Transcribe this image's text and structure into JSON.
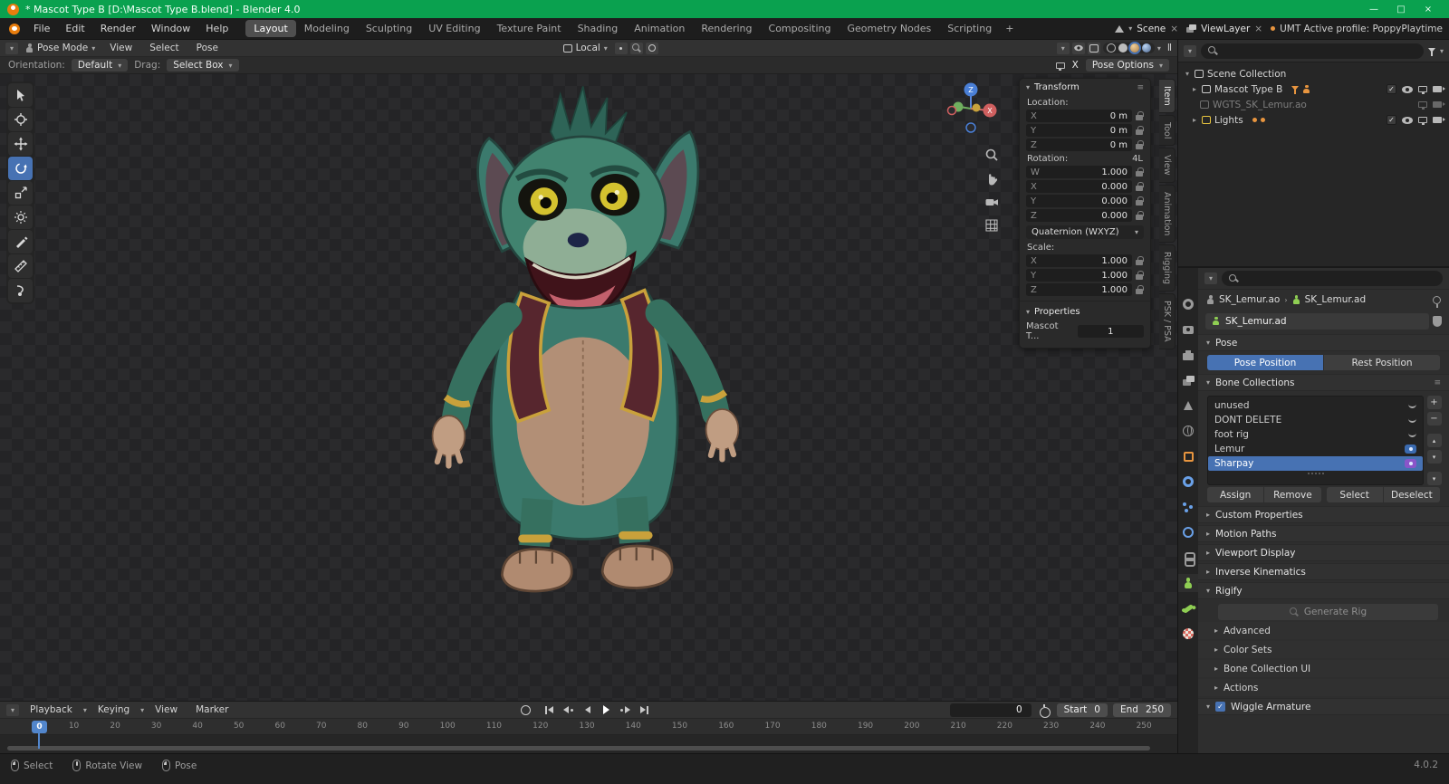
{
  "glyphs": {
    "chevron_down": "▾",
    "chevron_right": "▸",
    "chevron_up": "▴",
    "plus": "+",
    "minus": "−",
    "close": "×",
    "check": "✓",
    "grip": "≡",
    "pause": "Ⅱ",
    "minimize": "—",
    "maximize": "□",
    "crumb_sep": "›"
  },
  "window": {
    "title": "* Mascot Type B [D:\\Mascot Type B.blend] - Blender 4.0"
  },
  "menubar": {
    "menus": [
      "File",
      "Edit",
      "Render",
      "Window",
      "Help"
    ],
    "workspaces": [
      "Layout",
      "Modeling",
      "Sculpting",
      "UV Editing",
      "Texture Paint",
      "Shading",
      "Animation",
      "Rendering",
      "Compositing",
      "Geometry Nodes",
      "Scripting"
    ],
    "active_workspace": "Layout",
    "add_workspace": "+",
    "scene_selector": {
      "label": "Scene"
    },
    "viewlayer_selector": {
      "label": "ViewLayer"
    },
    "profile_text": "UMT Active profile: PoppyPlaytime"
  },
  "viewport": {
    "header": {
      "mode": "Pose Mode",
      "menus": [
        "View",
        "Select",
        "Pose"
      ],
      "orientation": "Local"
    },
    "subheader": {
      "orientation_label": "Orientation:",
      "orientation_value": "Default",
      "drag_label": "Drag:",
      "drag_value": "Select Box",
      "mirror_axis": "X",
      "pose_options": "Pose Options"
    },
    "gizmo": {
      "x": "X",
      "z": "Z"
    },
    "side_tabs": [
      "Item",
      "Tool",
      "View",
      "Animation",
      "Rigging",
      "PSK / PSA"
    ],
    "active_side_tab": "Item"
  },
  "n_panel": {
    "transform_title": "Transform",
    "location_label": "Location:",
    "location_rows": [
      {
        "axis": "X",
        "value": "0 m"
      },
      {
        "axis": "Y",
        "value": "0 m"
      },
      {
        "axis": "Z",
        "value": "0 m"
      }
    ],
    "rotation_label": "Rotation:",
    "rotation_badge": "4L",
    "rotation_rows": [
      {
        "axis": "W",
        "value": "1.000"
      },
      {
        "axis": "X",
        "value": "0.000"
      },
      {
        "axis": "Y",
        "value": "0.000"
      },
      {
        "axis": "Z",
        "value": "0.000"
      }
    ],
    "rotation_mode": "Quaternion (WXYZ)",
    "scale_label": "Scale:",
    "scale_rows": [
      {
        "axis": "X",
        "value": "1.000"
      },
      {
        "axis": "Y",
        "value": "1.000"
      },
      {
        "axis": "Z",
        "value": "1.000"
      }
    ],
    "properties_title": "Properties",
    "custom_prop_label": "Mascot T...",
    "custom_prop_value": "1"
  },
  "outliner": {
    "search_placeholder": "",
    "items": [
      {
        "label": "Scene Collection"
      },
      {
        "label": "Mascot Type B"
      },
      {
        "label": "WGTS_SK_Lemur.ao"
      },
      {
        "label": "Lights"
      }
    ]
  },
  "properties": {
    "search_placeholder": "",
    "breadcrumb": {
      "object": "SK_Lemur.ao",
      "data": "SK_Lemur.ad"
    },
    "name_field": "SK_Lemur.ad",
    "pose_panel": {
      "title": "Pose",
      "pose_position": "Pose Position",
      "rest_position": "Rest Position",
      "active": "Pose Position"
    },
    "bone_collections": {
      "title": "Bone Collections",
      "rows": [
        {
          "name": "unused"
        },
        {
          "name": "DONT DELETE"
        },
        {
          "name": "foot rig"
        },
        {
          "name": "Lemur"
        },
        {
          "name": "Sharpay"
        }
      ],
      "selected": "Sharpay",
      "buttons": [
        "Assign",
        "Remove",
        "Select",
        "Deselect"
      ]
    },
    "collapsed_panels": [
      "Custom Properties",
      "Motion Paths",
      "Viewport Display",
      "Inverse Kinematics"
    ],
    "rigify": {
      "title": "Rigify",
      "generate_button": "Generate Rig",
      "sub_panels": [
        "Advanced",
        "Color Sets",
        "Bone Collection UI",
        "Actions"
      ]
    },
    "wiggle": {
      "title": "Wiggle Armature",
      "checked": true
    }
  },
  "timeline": {
    "menus": [
      "Playback",
      "Keying",
      "View",
      "Marker"
    ],
    "current_frame": "0",
    "start_label": "Start",
    "start_value": "0",
    "end_label": "End",
    "end_value": "250",
    "playhead_frame": "0",
    "ruler": [
      "0",
      "10",
      "20",
      "30",
      "40",
      "50",
      "60",
      "70",
      "80",
      "90",
      "100",
      "110",
      "120",
      "130",
      "140",
      "150",
      "160",
      "170",
      "180",
      "190",
      "200",
      "210",
      "220",
      "230",
      "240",
      "250"
    ]
  },
  "statusbar": {
    "hints": [
      {
        "icon": "left-mouse",
        "label": "Select"
      },
      {
        "icon": "middle-mouse",
        "label": "Rotate View"
      },
      {
        "icon": "left-mouse",
        "label": "Pose"
      }
    ],
    "version": "4.0.2"
  }
}
